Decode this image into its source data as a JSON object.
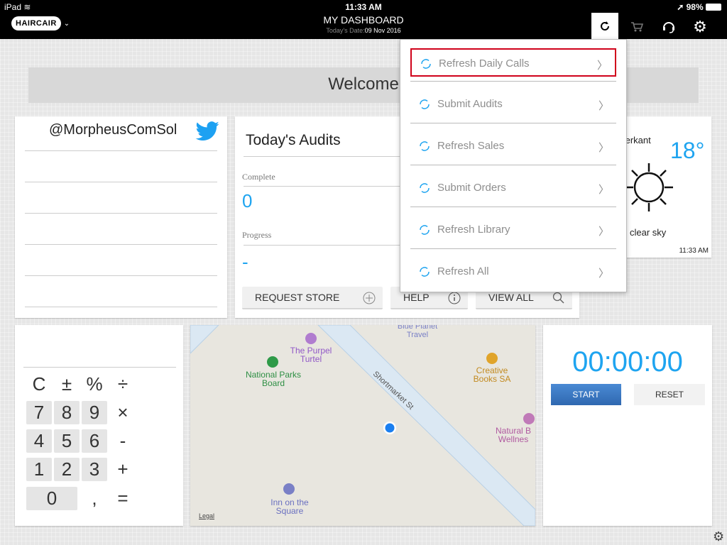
{
  "status": {
    "device": "iPad",
    "time": "11:33 AM",
    "battery": "98%"
  },
  "header": {
    "brand": "HAIRCAIR",
    "title": "MY DASHBOARD",
    "date_label": "Today's Date:",
    "date_value": "09 Nov 2016"
  },
  "welcome": "Welcome",
  "twitter": {
    "handle": "@MorpheusComSol"
  },
  "audits": {
    "title": "Today's Audits",
    "complete_label": "Complete",
    "complete_value": "0",
    "progress_label": "Progress",
    "progress_value": "-",
    "buttons": {
      "request": "REQUEST STORE",
      "help": "HELP",
      "view_all": "VIEW ALL"
    }
  },
  "weather": {
    "location": "terkant",
    "temp": "18°",
    "desc": "clear sky",
    "time": "11:33 AM"
  },
  "calculator": {
    "rows": [
      [
        "C",
        "±",
        "%",
        "÷"
      ],
      [
        "7",
        "8",
        "9",
        "×"
      ],
      [
        "4",
        "5",
        "6",
        "-"
      ],
      [
        "1",
        "2",
        "3",
        "+"
      ],
      [
        "0",
        "",
        ",",
        "="
      ]
    ]
  },
  "map": {
    "street": "Shortmarket St",
    "legal": "Legal",
    "pois": [
      {
        "name": "Blue Planet Travel"
      },
      {
        "name": "The Purpel Turtel"
      },
      {
        "name": "National Parks Board"
      },
      {
        "name": "Creative Books SA"
      },
      {
        "name": "Natural B Wellnes"
      },
      {
        "name": "Inn on the Square"
      }
    ]
  },
  "timer": {
    "display": "00:00:00",
    "start": "START",
    "reset": "RESET"
  },
  "dropdown": {
    "items": [
      {
        "label": "Refresh Daily Calls",
        "selected": true
      },
      {
        "label": "Submit Audits"
      },
      {
        "label": "Refresh Sales"
      },
      {
        "label": "Submit Orders"
      },
      {
        "label": "Refresh Library"
      },
      {
        "label": "Refresh All"
      }
    ]
  },
  "colors": {
    "accent": "#1ea4f0",
    "twitter": "#1da1f2",
    "highlight": "#d0021b",
    "start_button": "#3a78c2"
  }
}
